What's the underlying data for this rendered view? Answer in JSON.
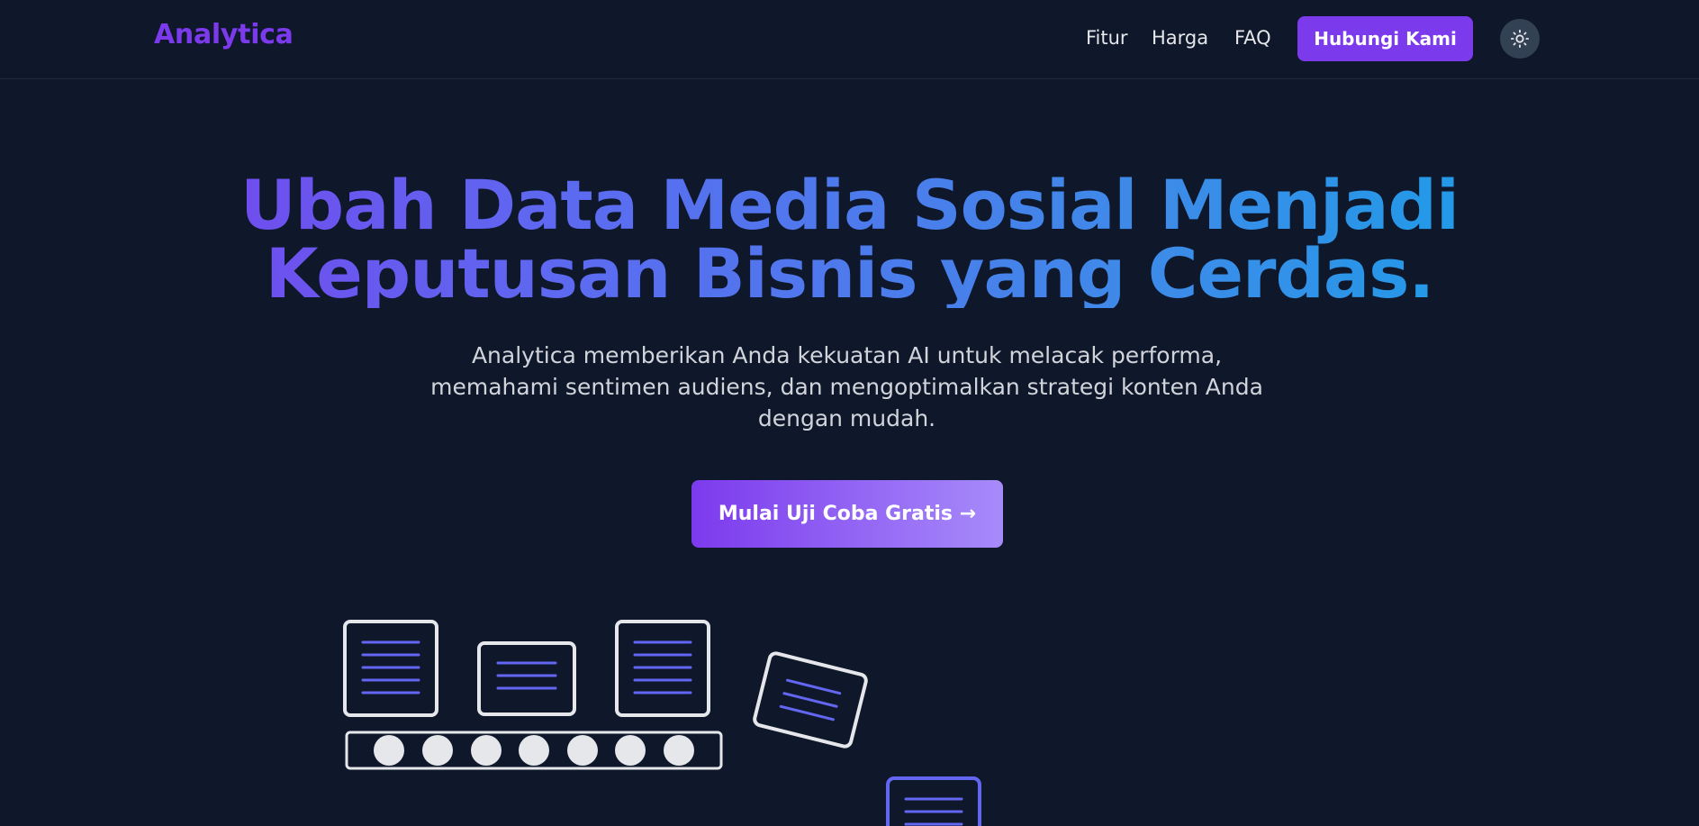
{
  "navbar": {
    "brand": "Analytica",
    "links": [
      "Fitur",
      "Harga",
      "FAQ"
    ],
    "contact_button": "Hubungi Kami",
    "theme_toggle_icon": "sun-icon"
  },
  "hero": {
    "title_line1": "Ubah Data Media Sosial Menjadi",
    "title_line2": "Keputusan Bisnis yang Cerdas.",
    "subtitle": "Analytica memberikan Anda kekuatan AI untuk melacak performa, memahami sentimen audiens, dan mengoptimalkan strategi konten Anda dengan mudah.",
    "cta_label": "Mulai Uji Coba Gratis →"
  },
  "illustration": {
    "icon": "document-conveyor-icon"
  },
  "colors": {
    "background": "#0f172a",
    "brand": "#7c3aed",
    "gradient_start": "#7c3aed",
    "gradient_end": "#0ea5e9",
    "document_line": "#6366f1"
  }
}
